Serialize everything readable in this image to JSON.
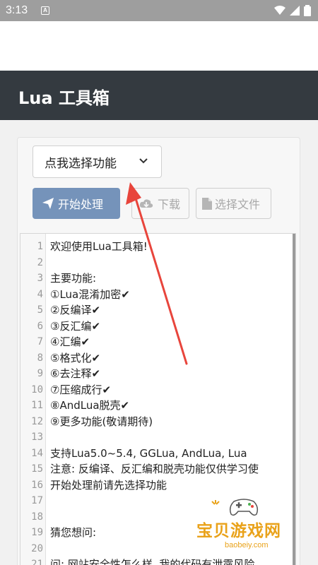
{
  "status_bar": {
    "time": "3:13",
    "a_icon": "A"
  },
  "app_bar": {
    "title": "Lua 工具箱"
  },
  "select": {
    "label": "点我选择功能"
  },
  "buttons": {
    "start": "开始处理",
    "download": "下载",
    "file": "选择文件"
  },
  "editor": {
    "lines": [
      {
        "n": "1",
        "text": "欢迎使用Lua工具箱!"
      },
      {
        "n": "2",
        "text": ""
      },
      {
        "n": "3",
        "text": "主要功能:"
      },
      {
        "n": "4",
        "text": "①Lua混淆加密✔"
      },
      {
        "n": "5",
        "text": "②反编译✔"
      },
      {
        "n": "6",
        "text": "③反汇编✔"
      },
      {
        "n": "7",
        "text": "④汇编✔"
      },
      {
        "n": "8",
        "text": "⑤格式化✔"
      },
      {
        "n": "9",
        "text": "⑥去注释✔"
      },
      {
        "n": "10",
        "text": "⑦压缩成行✔"
      },
      {
        "n": "11",
        "text": "⑧AndLua脱壳✔"
      },
      {
        "n": "12",
        "text": "⑨更多功能(敬请期待)"
      },
      {
        "n": "13",
        "text": ""
      },
      {
        "n": "14",
        "text": "支持Lua5.0~5.4, GGLua, AndLua, Lua"
      },
      {
        "n": "15",
        "text": "注意: 反编译、反汇编和脱壳功能仅供学习使"
      },
      {
        "n": "16",
        "text": "开始处理前请先选择功能"
      },
      {
        "n": "17",
        "text": ""
      },
      {
        "n": "18",
        "text": ""
      },
      {
        "n": "19",
        "text": "猜您想问:"
      },
      {
        "n": "20",
        "text": ""
      },
      {
        "n": "21",
        "text": "问: 网站安全性怎么样, 我的代码有泄露风险"
      }
    ]
  },
  "watermark": {
    "title": "宝贝游戏网",
    "domain": "baobeiy.com"
  },
  "colors": {
    "app_bar": "#343a40",
    "start_button": "#7593ba",
    "arrow": "#e8453c"
  }
}
